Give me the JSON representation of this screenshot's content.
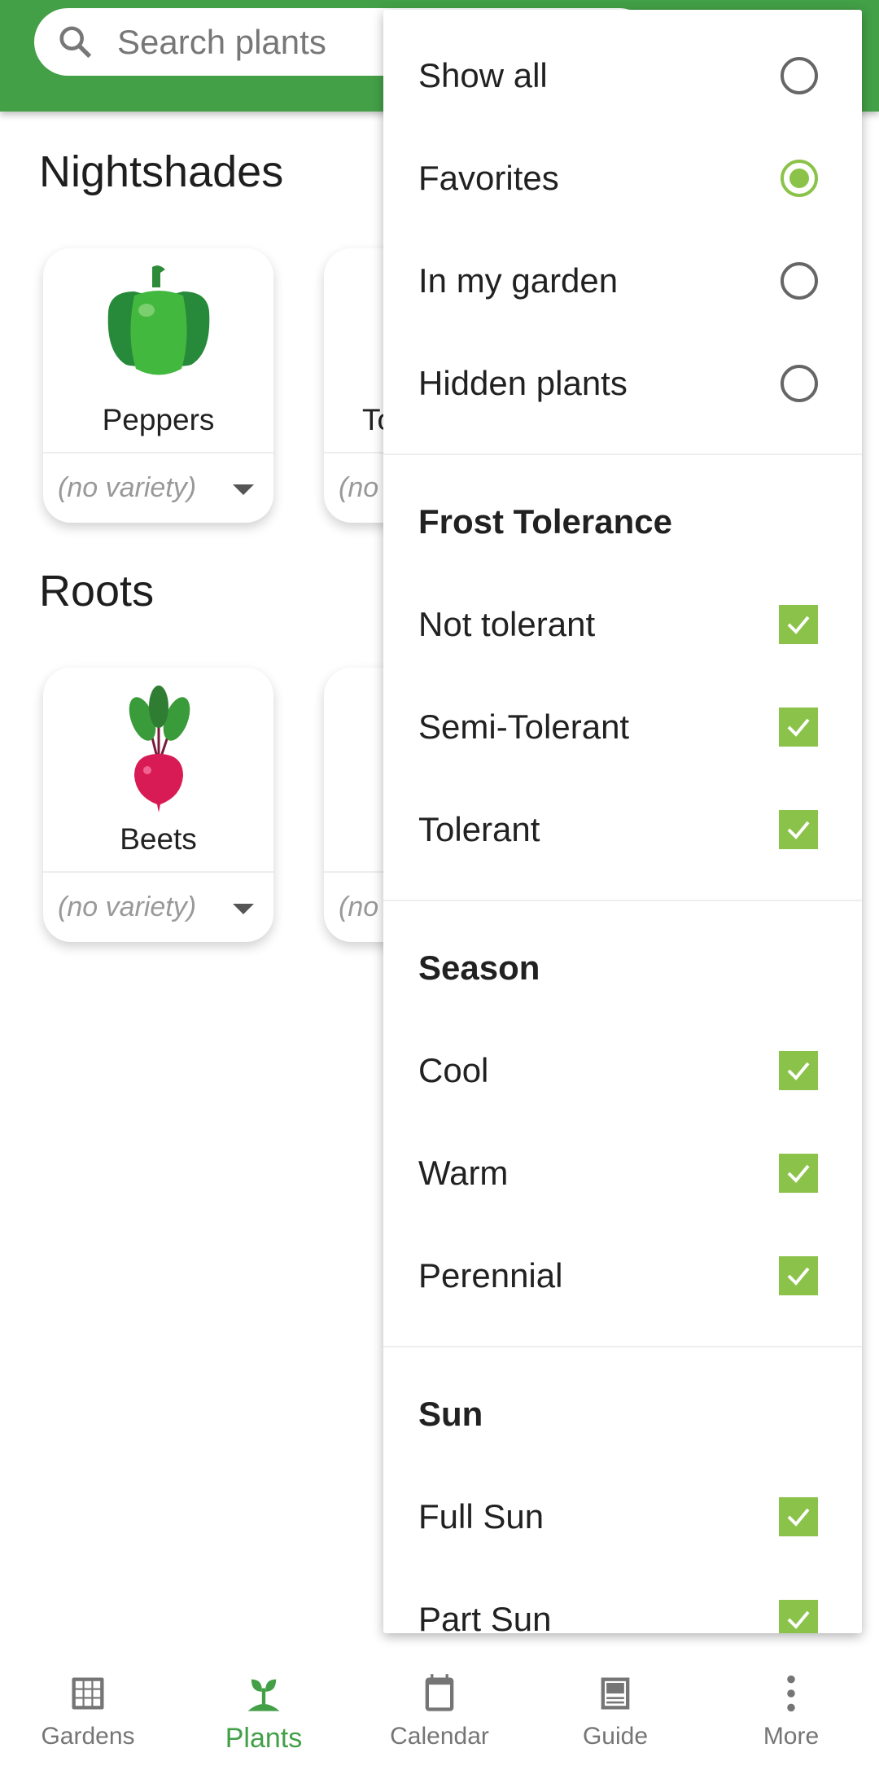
{
  "search": {
    "placeholder": "Search plants",
    "icon": "search-icon"
  },
  "sections": [
    {
      "title": "Nightshades",
      "cards": [
        {
          "name": "Peppers",
          "variety": "(no variety)",
          "icon": "bell-pepper"
        },
        {
          "name": "To",
          "variety": "(no",
          "icon": ""
        }
      ]
    },
    {
      "title": "Roots",
      "cards": [
        {
          "name": "Beets",
          "variety": "(no variety)",
          "icon": "beet"
        },
        {
          "name": "",
          "variety": "(no",
          "icon": ""
        }
      ]
    }
  ],
  "menu": {
    "show": [
      {
        "label": "Show all",
        "selected": false
      },
      {
        "label": "Favorites",
        "selected": true
      },
      {
        "label": "In my garden",
        "selected": false
      },
      {
        "label": "Hidden plants",
        "selected": false
      }
    ],
    "frost": {
      "title": "Frost Tolerance",
      "items": [
        {
          "label": "Not tolerant",
          "checked": true
        },
        {
          "label": "Semi-Tolerant",
          "checked": true
        },
        {
          "label": "Tolerant",
          "checked": true
        }
      ]
    },
    "season": {
      "title": "Season",
      "items": [
        {
          "label": "Cool",
          "checked": true
        },
        {
          "label": "Warm",
          "checked": true
        },
        {
          "label": "Perennial",
          "checked": true
        }
      ]
    },
    "sun": {
      "title": "Sun",
      "items": [
        {
          "label": "Full Sun",
          "checked": true
        },
        {
          "label": "Part Sun",
          "checked": true
        }
      ]
    }
  },
  "nav": [
    {
      "label": "Gardens",
      "icon": "grid-icon"
    },
    {
      "label": "Plants",
      "icon": "sprout-icon",
      "active": true
    },
    {
      "label": "Calendar",
      "icon": "calendar-icon"
    },
    {
      "label": "Guide",
      "icon": "guide-icon"
    },
    {
      "label": "More",
      "icon": "more-vert-icon"
    }
  ],
  "colors": {
    "primary": "#43a047",
    "accent": "#8bc34a"
  }
}
